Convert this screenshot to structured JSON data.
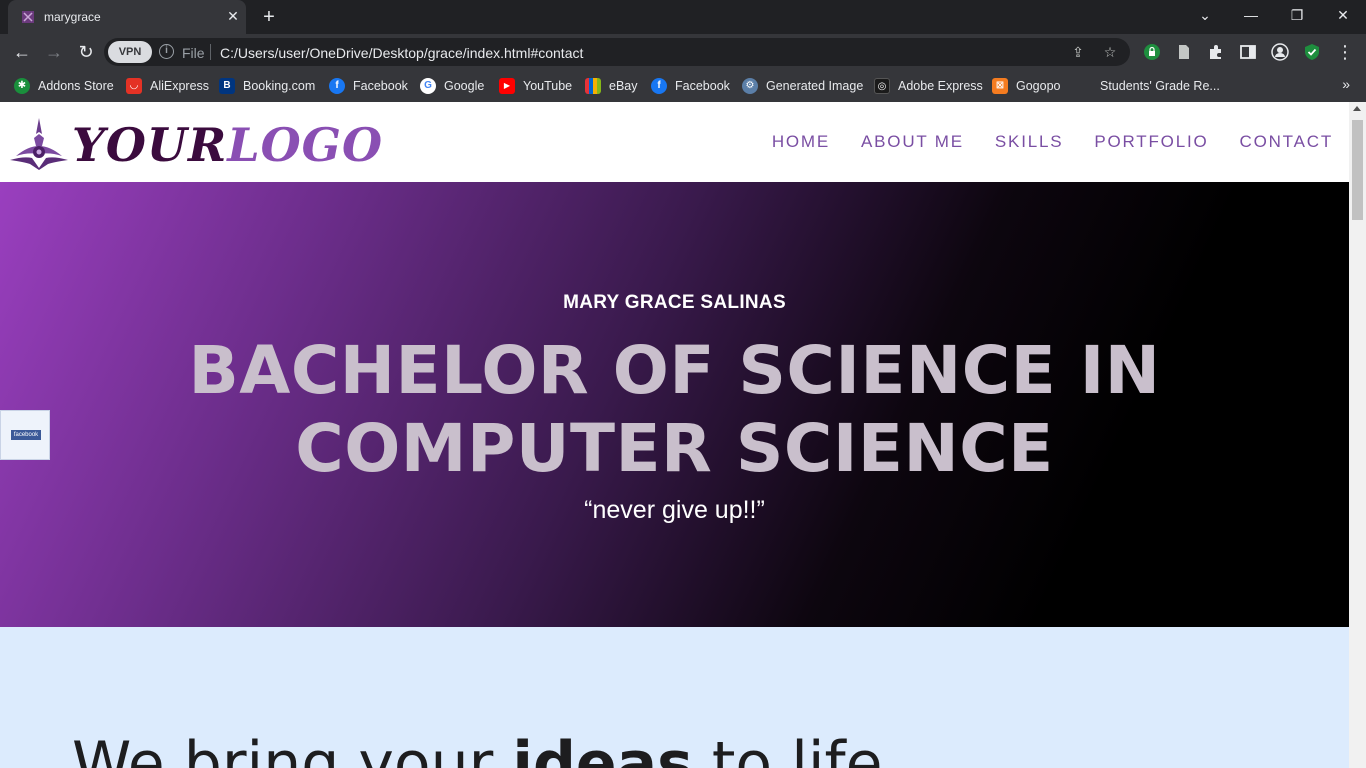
{
  "browser": {
    "tab": {
      "title": "marygrace"
    },
    "address": {
      "vpn_label": "VPN",
      "scheme_label": "File",
      "url": "C:/Users/user/OneDrive/Desktop/grace/index.html#contact"
    },
    "bookmarks": [
      {
        "label": "Addons Store",
        "icon": "addons-icon",
        "color": "#1a8f3c",
        "glyph": "✱"
      },
      {
        "label": "AliExpress",
        "icon": "aliexpress-icon",
        "color": "#e43225",
        "glyph": "◡"
      },
      {
        "label": "Booking.com",
        "icon": "booking-icon",
        "color": "#003580",
        "glyph": "B"
      },
      {
        "label": "Facebook",
        "icon": "facebook-icon",
        "color": "#1877f2",
        "glyph": "f"
      },
      {
        "label": "Google",
        "icon": "google-icon",
        "color": "#ffffff",
        "glyph": "G"
      },
      {
        "label": "YouTube",
        "icon": "youtube-icon",
        "color": "#ff0000",
        "glyph": "▶"
      },
      {
        "label": "eBay",
        "icon": "ebay-icon",
        "color": "#2d2d2d",
        "glyph": "◼"
      },
      {
        "label": "Facebook",
        "icon": "facebook-icon",
        "color": "#1877f2",
        "glyph": "f"
      },
      {
        "label": "Generated Image",
        "icon": "generated-image-icon",
        "color": "#5b7fa8",
        "glyph": "⚙"
      },
      {
        "label": "Adobe Express",
        "icon": "adobe-express-icon",
        "color": "#1b1b1b",
        "glyph": "◎"
      },
      {
        "label": "Gogopo",
        "icon": "gogopo-icon",
        "color": "#f57c20",
        "glyph": "⊠"
      },
      {
        "label": "Students' Grade Re...",
        "icon": "",
        "color": "",
        "glyph": ""
      }
    ]
  },
  "site": {
    "logo": {
      "part1": "YOUR",
      "part2": "LOGO"
    },
    "nav": [
      "HOME",
      "ABOUT ME",
      "SKILLS",
      "PORTFOLIO",
      "CONTACT"
    ],
    "hero": {
      "name": "MARY GRACE SALINAS",
      "title": "BACHELOR OF SCIENCE IN COMPUTER SCIENCE",
      "quote": "“never give up!!”"
    },
    "fb_widget_label": "facebook",
    "tagline": {
      "pre": "We bring your ",
      "bold": "ideas",
      "post": " to life"
    }
  }
}
